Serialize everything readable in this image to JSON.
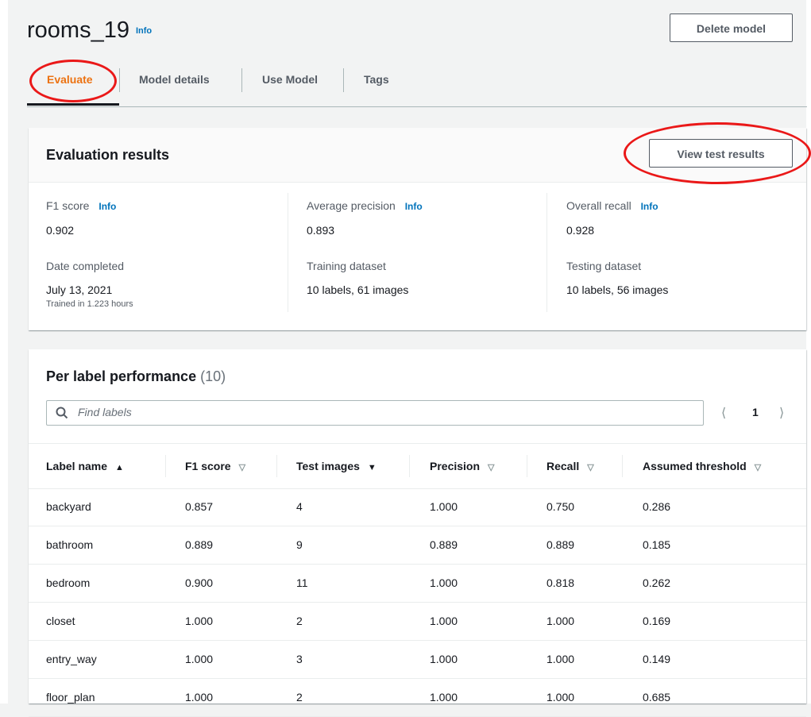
{
  "page": {
    "title": "rooms_19",
    "title_info": "Info",
    "delete_label": "Delete model"
  },
  "tabs": [
    {
      "label": "Evaluate",
      "active": true
    },
    {
      "label": "Model details"
    },
    {
      "label": "Use Model"
    },
    {
      "label": "Tags"
    }
  ],
  "evaluation": {
    "title": "Evaluation results",
    "view_label": "View test results",
    "f1": {
      "label": "F1 score",
      "info": "Info",
      "value": "0.902"
    },
    "precision": {
      "label": "Average precision",
      "info": "Info",
      "value": "0.893"
    },
    "recall": {
      "label": "Overall recall",
      "info": "Info",
      "value": "0.928"
    },
    "date": {
      "label": "Date completed",
      "value": "July 13, 2021",
      "note": "Trained in 1.223 hours"
    },
    "training": {
      "label": "Training dataset",
      "value": "10 labels, 61 images"
    },
    "testing": {
      "label": "Testing dataset",
      "value": "10 labels, 56 images"
    }
  },
  "performance": {
    "title": "Per label performance",
    "count": "(10)",
    "search_placeholder": "Find labels",
    "page": "1",
    "columns": [
      "Label name",
      "F1 score",
      "Test images",
      "Precision",
      "Recall",
      "Assumed threshold"
    ],
    "rows": [
      {
        "label": "backyard",
        "f1": "0.857",
        "images": "4",
        "precision": "1.000",
        "recall": "0.750",
        "threshold": "0.286"
      },
      {
        "label": "bathroom",
        "f1": "0.889",
        "images": "9",
        "precision": "0.889",
        "recall": "0.889",
        "threshold": "0.185"
      },
      {
        "label": "bedroom",
        "f1": "0.900",
        "images": "11",
        "precision": "1.000",
        "recall": "0.818",
        "threshold": "0.262"
      },
      {
        "label": "closet",
        "f1": "1.000",
        "images": "2",
        "precision": "1.000",
        "recall": "1.000",
        "threshold": "0.169"
      },
      {
        "label": "entry_way",
        "f1": "1.000",
        "images": "3",
        "precision": "1.000",
        "recall": "1.000",
        "threshold": "0.149"
      },
      {
        "label": "floor_plan",
        "f1": "1.000",
        "images": "2",
        "precision": "1.000",
        "recall": "1.000",
        "threshold": "0.685"
      }
    ]
  },
  "colors": {
    "accent": "#ec7211",
    "link": "#0073bb",
    "annotation": "#ea1818"
  }
}
